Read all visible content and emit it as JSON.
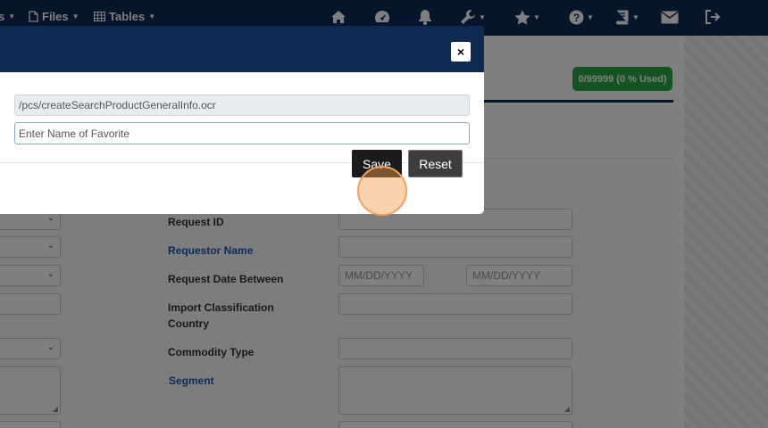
{
  "navbar": {
    "items": [
      {
        "label": "s",
        "has_caret": true
      },
      {
        "label": "Files",
        "icon": "file-icon",
        "has_caret": true
      },
      {
        "label": "Tables",
        "icon": "table-icon",
        "has_caret": true
      }
    ],
    "icons": [
      "home-icon",
      "dashboard-icon",
      "bell-icon",
      "wrench-icon",
      "star-icon",
      "help-icon",
      "book-icon",
      "envelope-icon",
      "logout-icon"
    ]
  },
  "page": {
    "usage_badge": "0/99999 (0 % Used)",
    "fields": {
      "request_id": "Request ID",
      "requestor_name": "Requestor Name",
      "request_date_between": "Request Date Between",
      "date_from_placeholder": "MM/DD/YYYY",
      "date_to_placeholder": "MM/DD/YYYY",
      "import_classification_country": "Import Classification Country",
      "commodity_type": "Commodity Type",
      "segment": "Segment"
    }
  },
  "modal": {
    "path_value": "/pcs/createSearchProductGeneralInfo.ocr",
    "favorite_placeholder": "Enter Name of Favorite",
    "save_label": "Save",
    "reset_label": "Reset",
    "close_glyph": "×"
  },
  "colors": {
    "navy": "#0d2a52",
    "badge_green": "#27a844",
    "link_blue": "#1a55b8",
    "highlight": "#f0a060"
  }
}
